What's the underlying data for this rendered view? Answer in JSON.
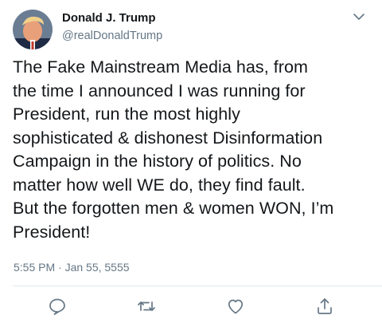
{
  "author": {
    "name": "Donald J. Trump",
    "handle": "@realDonaldTrump",
    "avatar_icon": "avatar-photo"
  },
  "tweet": {
    "text": "The Fake Mainstream Media has, from\nthe time I announced I was running for\nPresident, run the most highly\nsophisticated & dishonest Disinformation\nCampaign in the history of politics. No\nmatter how well WE do, they find fault.\nBut the forgotten men & women WON, I’m\nPresident!",
    "timestamp": "5:55 PM · Jan 55, 5555"
  },
  "actions": [
    {
      "name": "reply",
      "icon": "reply-icon"
    },
    {
      "name": "retweet",
      "icon": "retweet-icon"
    },
    {
      "name": "like",
      "icon": "heart-icon"
    },
    {
      "name": "share",
      "icon": "share-icon"
    }
  ],
  "colors": {
    "text_primary": "#14171a",
    "text_secondary": "#657786",
    "icon": "#657786",
    "divider": "#e1e8ed"
  }
}
